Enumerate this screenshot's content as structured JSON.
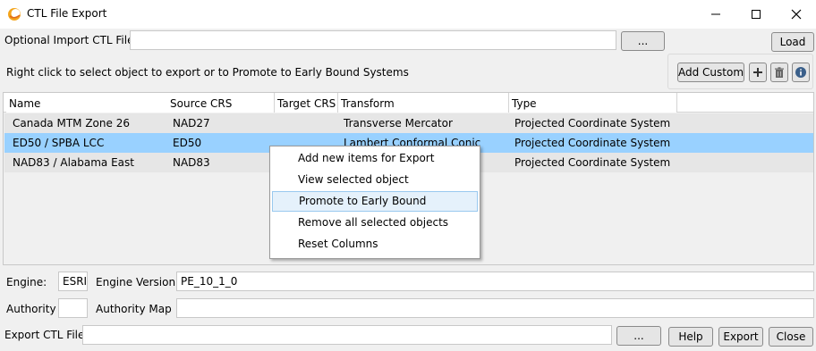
{
  "window": {
    "title": "CTL File Export",
    "controls": {
      "minimize": "minimize-icon",
      "maximize": "maximize-icon",
      "close": "close-icon"
    }
  },
  "import": {
    "label": "Optional Import CTL File:",
    "value": "",
    "browse_label": "...",
    "load_label": "Load"
  },
  "instructions": "Right click to select object to export or to Promote to Early Bound Systems",
  "toolbar": {
    "add_custom_label": "Add Custom",
    "icons": [
      "plus-icon",
      "trash-icon",
      "info-icon"
    ]
  },
  "table": {
    "columns": [
      "Name",
      "Source CRS",
      "Target CRS",
      "Transform",
      "Type"
    ],
    "rows": [
      {
        "name": "Canada MTM Zone 26",
        "source": "NAD27",
        "target": "",
        "transform": "Transverse Mercator",
        "type": "Projected Coordinate System",
        "selected": false
      },
      {
        "name": "ED50 / SPBA LCC",
        "source": "ED50",
        "target": "",
        "transform": "Lambert Conformal Conic",
        "type": "Projected Coordinate System",
        "selected": true
      },
      {
        "name": "NAD83 / Alabama East",
        "source": "NAD83",
        "target": "",
        "transform": "",
        "type": "Projected Coordinate System",
        "selected": false
      }
    ]
  },
  "context_menu": {
    "items": [
      "Add new items for Export",
      "View selected object",
      "Promote to Early Bound",
      "Remove all selected objects",
      "Reset Columns"
    ],
    "hovered_index": 2
  },
  "engine": {
    "label": "Engine:",
    "value": "ESRI",
    "version_label": "Engine Version:",
    "version_value": "PE_10_1_0"
  },
  "authority": {
    "label": "Authority",
    "value": "",
    "map_label": "Authority Map",
    "map_value": ""
  },
  "export": {
    "label": "Export CTL File:",
    "value": "",
    "browse_label": "...",
    "help_label": "Help",
    "export_label": "Export",
    "close_label": "Close"
  },
  "colors": {
    "selected_row": "#99d1ff",
    "menu_hover": "#e5f1fb",
    "menu_hover_border": "#99c9ef"
  }
}
